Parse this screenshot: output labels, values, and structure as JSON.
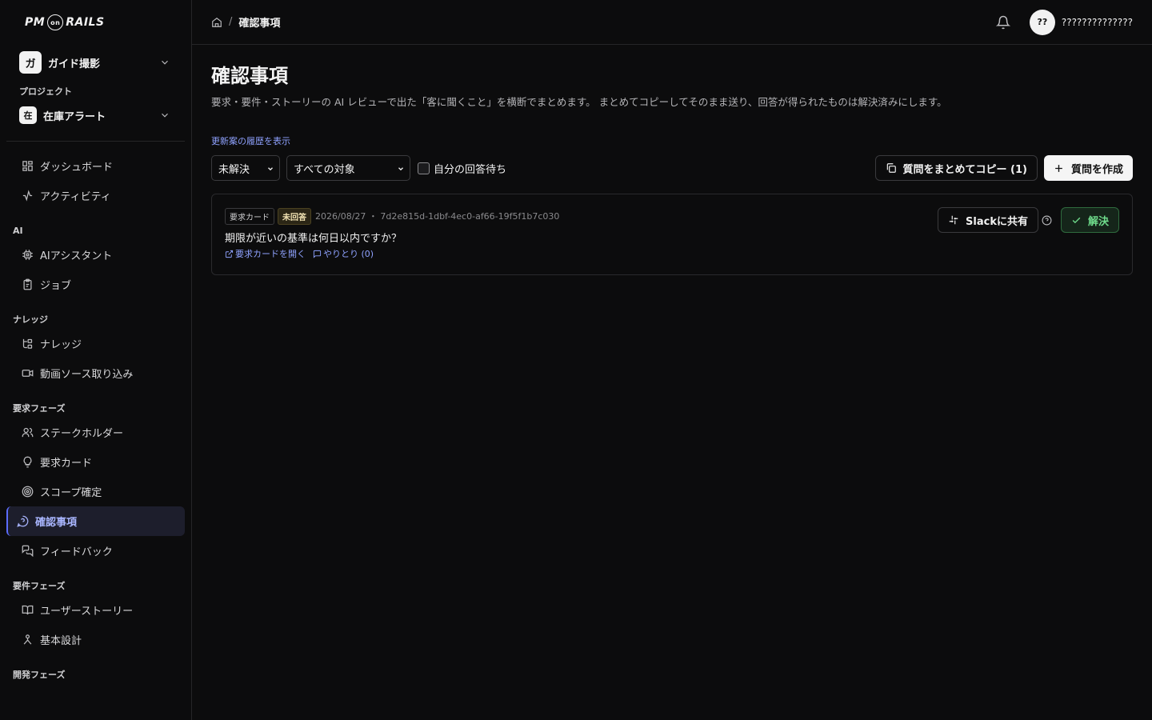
{
  "app": {
    "logo_left": "PM",
    "logo_on": "on",
    "logo_right": "RAILS"
  },
  "sidebar": {
    "workspace": {
      "badge": "ガ",
      "name": "ガイド撮影"
    },
    "project_caption": "プロジェクト",
    "project": {
      "badge": "在",
      "name": "在庫アラート"
    },
    "top_items": [
      {
        "label": "ダッシュボード",
        "icon": "dashboard-icon"
      },
      {
        "label": "アクティビティ",
        "icon": "activity-icon"
      }
    ],
    "groups": [
      {
        "label": "AI",
        "items": [
          {
            "label": "AIアシスタント",
            "icon": "cpu-icon"
          },
          {
            "label": "ジョブ",
            "icon": "clipboard-icon"
          }
        ]
      },
      {
        "label": "ナレッジ",
        "items": [
          {
            "label": "ナレッジ",
            "icon": "tree-icon"
          },
          {
            "label": "動画ソース取り込み",
            "icon": "video-icon"
          }
        ]
      },
      {
        "label": "要求フェーズ",
        "items": [
          {
            "label": "ステークホルダー",
            "icon": "users-icon"
          },
          {
            "label": "要求カード",
            "icon": "lightbulb-icon"
          },
          {
            "label": "スコープ確定",
            "icon": "target-icon"
          },
          {
            "label": "確認事項",
            "icon": "help-circle-icon",
            "active": true
          },
          {
            "label": "フィードバック",
            "icon": "messages-icon"
          }
        ]
      },
      {
        "label": "要件フェーズ",
        "items": [
          {
            "label": "ユーザーストーリー",
            "icon": "book-icon"
          },
          {
            "label": "基本設計",
            "icon": "person-icon"
          }
        ]
      },
      {
        "label": "開発フェーズ",
        "items": []
      }
    ]
  },
  "topbar": {
    "breadcrumb_current": "確認事項",
    "avatar_initials": "??",
    "username": "??????????????"
  },
  "page": {
    "title": "確認事項",
    "description": "要求・要件・ストーリーの AI レビューで出た「客に聞くこと」を横断でまとめます。 まとめてコピーしてそのまま送り、回答が得られたものは解決済みにします。",
    "history_link": "更新案の履歴を表示"
  },
  "filters": {
    "status_selected": "未解決",
    "target_selected": "すべての対象",
    "waiting_label": "自分の回答待ち",
    "waiting_checked": false
  },
  "actions": {
    "copy_all": "質問をまとめてコピー (1)",
    "create": "質問を作成"
  },
  "items": [
    {
      "type_tag": "要求カード",
      "status_tag": "未回答",
      "meta": "2026/08/27 ・ 7d2e815d-1dbf-4ec0-af66-19f5f1b7c030",
      "question": "期限が近いの基準は何日以内ですか？",
      "open_link": "要求カードを開く",
      "thread_link": "やりとり (0)",
      "slack_label": "Slackに共有",
      "resolve_label": "解決"
    }
  ],
  "colors": {
    "background": "#0c0c0d",
    "accent": "#8fa2ff",
    "active_nav_bg": "#1d1e2c",
    "resolve_green": "#6fdc8c",
    "pending_tag": "#2b2616"
  }
}
